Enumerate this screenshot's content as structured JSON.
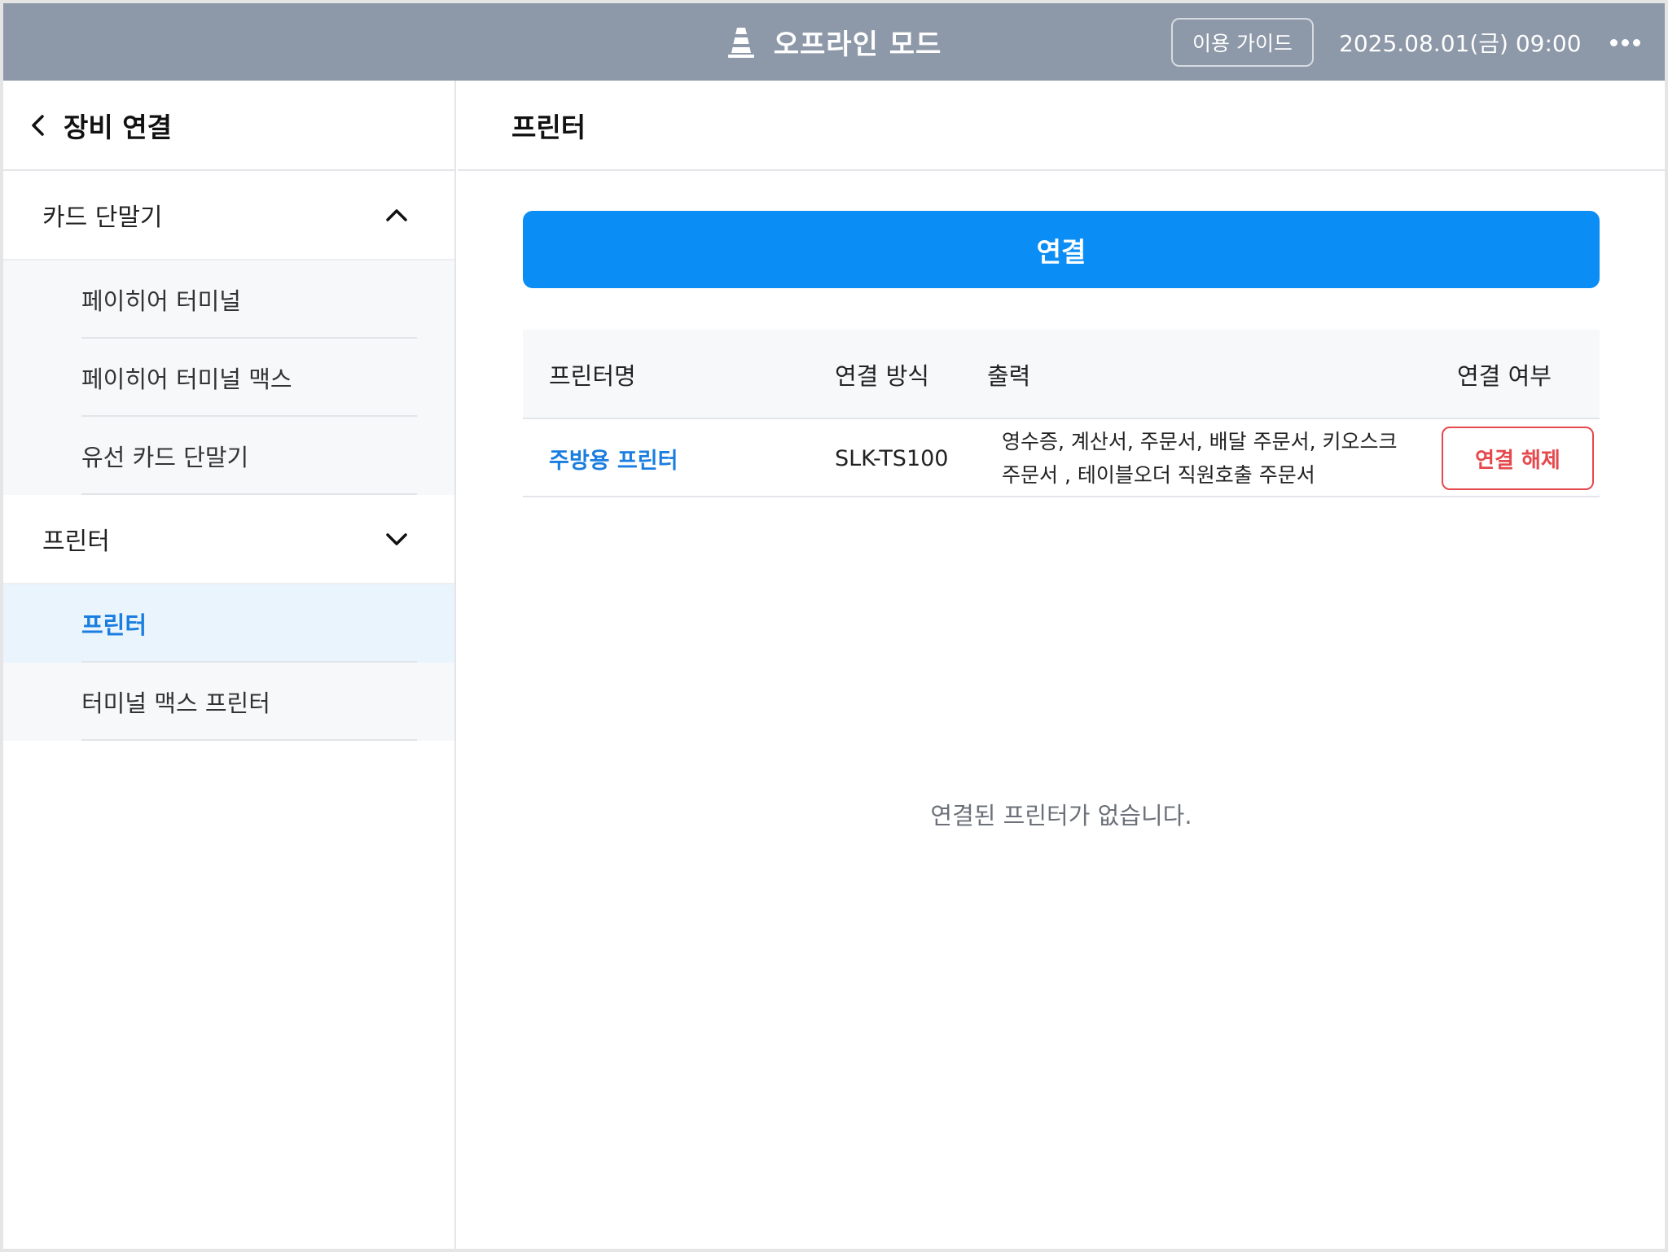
{
  "topbar": {
    "mode_title": "오프라인 모드",
    "guide_label": "이용 가이드",
    "datetime": "2025.08.01(금) 09:00"
  },
  "sidebar": {
    "title": "장비 연결",
    "groups": [
      {
        "label": "카드 단말기",
        "items": [
          {
            "label": "페이히어 터미널"
          },
          {
            "label": "페이히어 터미널 맥스"
          },
          {
            "label": "유선 카드 단말기"
          }
        ]
      },
      {
        "label": "프린터",
        "items": [
          {
            "label": "프린터"
          },
          {
            "label": "터미널 맥스 프린터"
          }
        ]
      }
    ]
  },
  "main": {
    "title": "프린터",
    "connect_label": "연결",
    "table": {
      "headers": [
        "프린터명",
        "연결 방식",
        "출력",
        "연결 여부"
      ],
      "rows": [
        {
          "name": "주방용 프린터",
          "method": "SLK-TS100",
          "output": "영수증, 계산서, 주문서, 배달 주문서, 키오스크 주문서 , 테이블오더 직원호출 주문서",
          "action": "연결 해제"
        }
      ]
    },
    "empty_message": "연결된 프린터가 없습니다."
  },
  "colors": {
    "topbar_bg": "#8d98a8",
    "accent": "#0a8df5",
    "link": "#1a7ee0",
    "danger": "#e5484d"
  },
  "icons": [
    "traffic-cone-icon",
    "more-dots-icon",
    "chevron-left-icon",
    "chevron-up-icon",
    "chevron-down-icon"
  ]
}
